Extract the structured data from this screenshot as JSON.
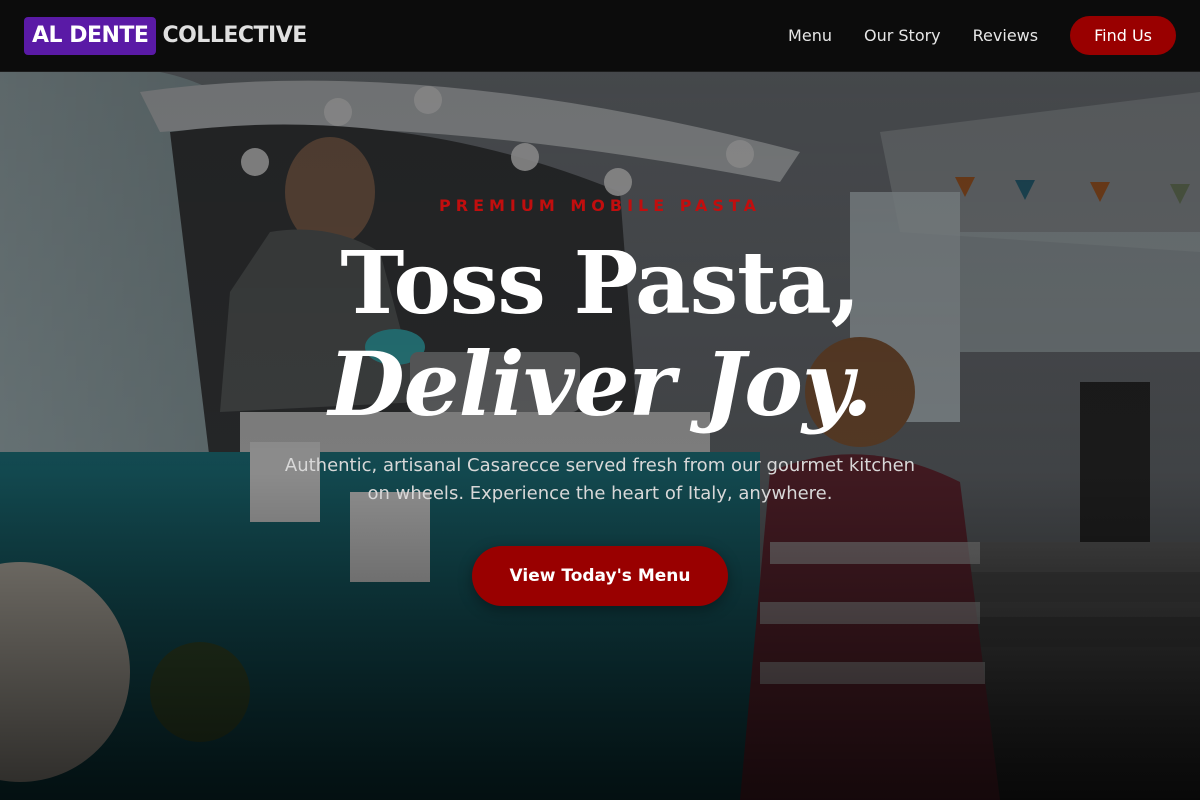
{
  "brand": {
    "name_part1": "AL DENTE",
    "name_part2": "COLLECTIVE"
  },
  "nav": {
    "links": [
      "Menu",
      "Our Story",
      "Reviews"
    ],
    "cta_label": "Find Us"
  },
  "hero": {
    "eyebrow": "PREMIUM MOBILE PASTA",
    "headline_line1": "Toss Pasta,",
    "headline_line2": "Deliver Joy.",
    "subtext": "Authentic, artisanal Casarecce served fresh from our gourmet kitchen on wheels. Experience the heart of Italy, anywhere.",
    "cta_label": "View Today's Menu",
    "background_image": "food-truck-chef-serving-customer-photo"
  },
  "colors": {
    "brand_purple": "#5a1aa6",
    "accent_red": "#990000",
    "eyebrow_red": "#c10e0e",
    "header_bg": "#0c0c0c"
  }
}
